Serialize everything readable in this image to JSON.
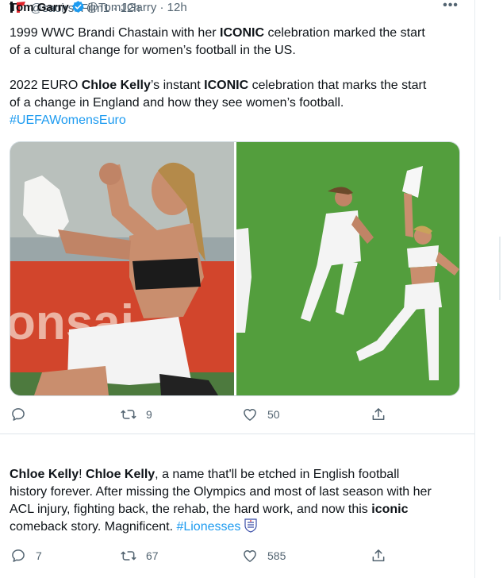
{
  "tweet1": {
    "handle": "@saoirseFilm1",
    "sep": "·",
    "time": "12h",
    "more": "•••",
    "p1_a": "1999 WWC Brandi Chastain with her ",
    "p1_bold": "ICONIC",
    "p1_b": " celebration marked the start",
    "p1_line2": "of a cultural change for women’s football in the US.",
    "p2_a": "2022 EURO ",
    "p2_bold1": "Chloe Kelly",
    "p2_b": "’s instant ",
    "p2_bold2": "ICONIC",
    "p2_c": " celebration that marks the start",
    "p2_line2": "of a change in England and how they see women’s football.",
    "hashtag": "#UEFAWomensEuro",
    "replies": "",
    "retweets": "9",
    "likes": "50"
  },
  "tweet2": {
    "name": "Tom Garry",
    "handle": "@TomJGarry",
    "sep": "·",
    "time": "12h",
    "more": "•••",
    "t_bold1": "Chloe Kelly",
    "t_a": "! ",
    "t_bold2": "Chloe Kelly",
    "t_b": ", a name that'll be etched in English football",
    "line2": "history forever. After missing the Olympics and most of last season with her",
    "line3_a": "ACL injury, fighting back, the rehab, the hard work, and now this ",
    "line3_bold": "iconic",
    "line4_a": "comeback story. Magnificent. ",
    "hashtag": "#Lionesses",
    "replies": "7",
    "retweets": "67",
    "likes": "585"
  },
  "colors": {
    "accent": "#1d9bf0",
    "secondary_text": "#536471",
    "verified": "#1d9bf0"
  },
  "icons": [
    "reply-icon",
    "retweet-icon",
    "like-icon",
    "share-icon",
    "verified-icon",
    "more-icon",
    "england-crest-icon"
  ]
}
